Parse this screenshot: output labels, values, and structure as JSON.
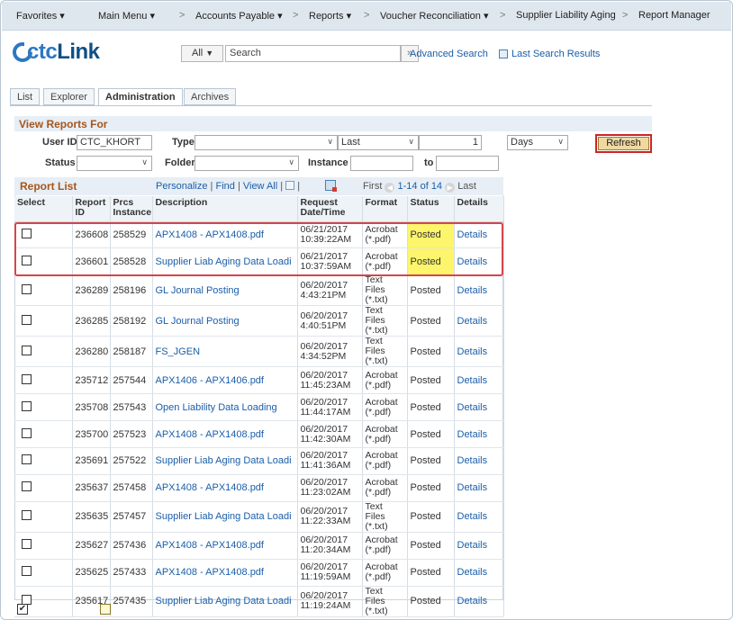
{
  "nav": {
    "favorites": "Favorites ▾",
    "main_menu": "Main Menu ▾",
    "accounts_payable": "Accounts Payable ▾",
    "reports": "Reports ▾",
    "voucher_reconciliation": "Voucher Reconciliation ▾",
    "supplier_liability_aging": "Supplier Liability Aging",
    "report_manager": "Report Manager",
    "separator": ">"
  },
  "header": {
    "logo_ctc": "ctc",
    "logo_link": "Link",
    "search_scope": "All",
    "search_placeholder": "Search",
    "search_go": "»",
    "advanced_search": "Advanced Search",
    "last_search_results": "Last Search Results"
  },
  "tabs": [
    {
      "label": "List"
    },
    {
      "label": "Explorer"
    },
    {
      "label": "Administration"
    },
    {
      "label": "Archives"
    }
  ],
  "view_reports": {
    "title": "View Reports For",
    "user_id_label": "User ID",
    "user_id_value": "CTC_KHORT",
    "type_label": "Type",
    "type_value": "",
    "last_value": "Last",
    "last_number": "1",
    "unit_value": "Days",
    "refresh": "Refresh",
    "status_label": "Status",
    "status_value": "",
    "folder_label": "Folder",
    "folder_value": "",
    "instance_label": "Instance",
    "instance_from": "",
    "to_label": "to",
    "instance_to": ""
  },
  "report_list": {
    "title": "Report List",
    "personalize": "Personalize",
    "find": "Find",
    "view_all": "View All",
    "first": "First",
    "range": "1-14 of 14",
    "last": "Last",
    "columns": [
      "Select",
      "Report ID",
      "Prcs Instance",
      "Description",
      "Request Date/Time",
      "Format",
      "Status",
      "Details"
    ],
    "rows": [
      {
        "report_id": "236608",
        "prcs": "258529",
        "desc": "APX1408 - APX1408.pdf",
        "date": "06/21/2017",
        "time": "10:39:22AM",
        "format1": "Acrobat",
        "format2": "(*.pdf)",
        "status": "Posted",
        "details": "Details"
      },
      {
        "report_id": "236601",
        "prcs": "258528",
        "desc": "Supplier Liab Aging Data Loadi",
        "date": "06/21/2017",
        "time": "10:37:59AM",
        "format1": "Acrobat",
        "format2": "(*.pdf)",
        "status": "Posted",
        "details": "Details"
      },
      {
        "report_id": "236289",
        "prcs": "258196",
        "desc": "GL Journal Posting",
        "date": "06/20/2017",
        "time": "4:43:21PM",
        "format1": "Text Files",
        "format2": "(*.txt)",
        "status": "Posted",
        "details": "Details"
      },
      {
        "report_id": "236285",
        "prcs": "258192",
        "desc": "GL Journal Posting",
        "date": "06/20/2017",
        "time": "4:40:51PM",
        "format1": "Text Files",
        "format2": "(*.txt)",
        "status": "Posted",
        "details": "Details"
      },
      {
        "report_id": "236280",
        "prcs": "258187",
        "desc": "FS_JGEN",
        "date": "06/20/2017",
        "time": "4:34:52PM",
        "format1": "Text Files",
        "format2": "(*.txt)",
        "status": "Posted",
        "details": "Details"
      },
      {
        "report_id": "235712",
        "prcs": "257544",
        "desc": "APX1406 - APX1406.pdf",
        "date": "06/20/2017",
        "time": "11:45:23AM",
        "format1": "Acrobat",
        "format2": "(*.pdf)",
        "status": "Posted",
        "details": "Details"
      },
      {
        "report_id": "235708",
        "prcs": "257543",
        "desc": "Open Liability Data Loading",
        "date": "06/20/2017",
        "time": "11:44:17AM",
        "format1": "Acrobat",
        "format2": "(*.pdf)",
        "status": "Posted",
        "details": "Details"
      },
      {
        "report_id": "235700",
        "prcs": "257523",
        "desc": "APX1408 - APX1408.pdf",
        "date": "06/20/2017",
        "time": "11:42:30AM",
        "format1": "Acrobat",
        "format2": "(*.pdf)",
        "status": "Posted",
        "details": "Details"
      },
      {
        "report_id": "235691",
        "prcs": "257522",
        "desc": "Supplier Liab Aging Data Loadi",
        "date": "06/20/2017",
        "time": "11:41:36AM",
        "format1": "Acrobat",
        "format2": "(*.pdf)",
        "status": "Posted",
        "details": "Details"
      },
      {
        "report_id": "235637",
        "prcs": "257458",
        "desc": "APX1408 - APX1408.pdf",
        "date": "06/20/2017",
        "time": "11:23:02AM",
        "format1": "Acrobat",
        "format2": "(*.pdf)",
        "status": "Posted",
        "details": "Details"
      },
      {
        "report_id": "235635",
        "prcs": "257457",
        "desc": "Supplier Liab Aging Data Loadi",
        "date": "06/20/2017",
        "time": "11:22:33AM",
        "format1": "Text Files",
        "format2": "(*.txt)",
        "status": "Posted",
        "details": "Details"
      },
      {
        "report_id": "235627",
        "prcs": "257436",
        "desc": "APX1408 - APX1408.pdf",
        "date": "06/20/2017",
        "time": "11:20:34AM",
        "format1": "Acrobat",
        "format2": "(*.pdf)",
        "status": "Posted",
        "details": "Details"
      },
      {
        "report_id": "235625",
        "prcs": "257433",
        "desc": "APX1408 - APX1408.pdf",
        "date": "06/20/2017",
        "time": "11:19:59AM",
        "format1": "Acrobat",
        "format2": "(*.pdf)",
        "status": "Posted",
        "details": "Details"
      },
      {
        "report_id": "235617",
        "prcs": "257435",
        "desc": "Supplier Liab Aging Data Loadi",
        "date": "06/20/2017",
        "time": "11:19:24AM",
        "format1": "Text Files",
        "format2": "(*.txt)",
        "status": "Posted",
        "details": "Details"
      }
    ]
  },
  "colors": {
    "accent_link": "#1a5ea9",
    "section_title": "#a5561d",
    "highlight_yellow": "#fdf56b",
    "callout_red": "#d7444a"
  }
}
